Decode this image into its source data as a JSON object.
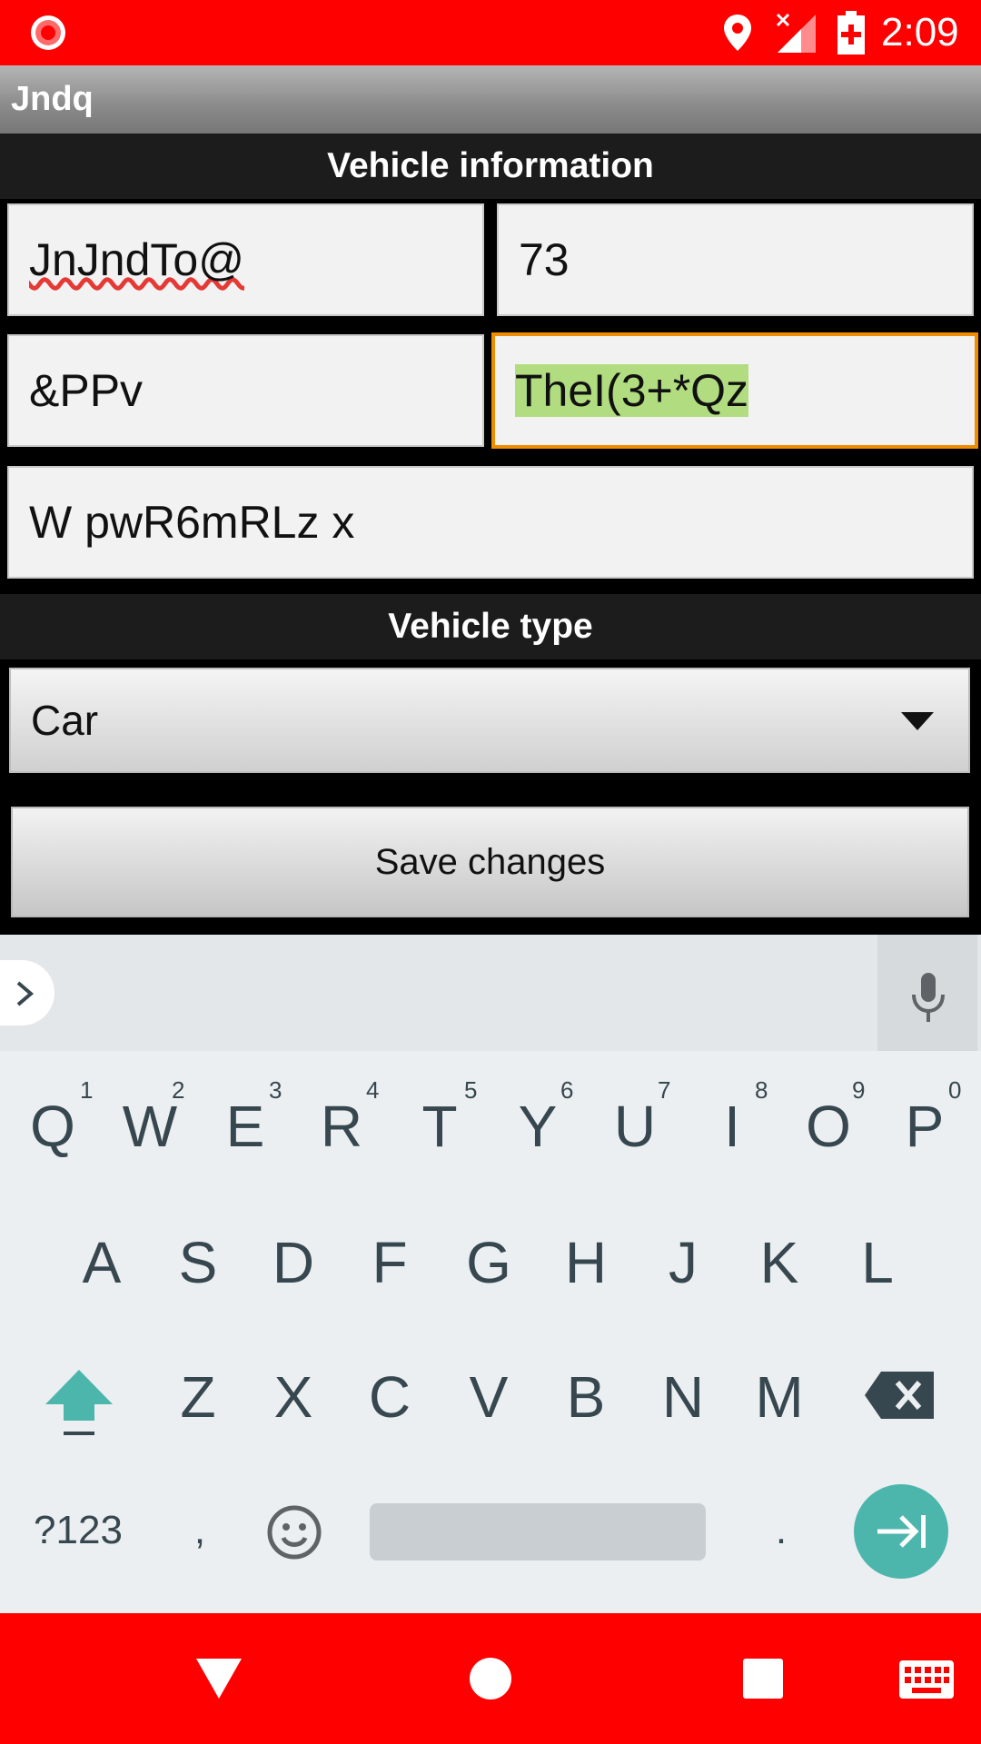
{
  "status_bar": {
    "time": "2:09"
  },
  "app": {
    "title": "Jndq"
  },
  "sections": {
    "vehicle_information": "Vehicle information",
    "vehicle_type": "Vehicle type"
  },
  "fields": {
    "field1": "JnJndTo@",
    "field2": "73",
    "field3": "&PPv",
    "field4": "TheI(3+*Qz",
    "field5": "W pwR6mRLz x"
  },
  "spinner": {
    "selected": "Car"
  },
  "buttons": {
    "save": "Save changes"
  },
  "keyboard": {
    "row1": [
      {
        "key": "Q",
        "hint": "1"
      },
      {
        "key": "W",
        "hint": "2"
      },
      {
        "key": "E",
        "hint": "3"
      },
      {
        "key": "R",
        "hint": "4"
      },
      {
        "key": "T",
        "hint": "5"
      },
      {
        "key": "Y",
        "hint": "6"
      },
      {
        "key": "U",
        "hint": "7"
      },
      {
        "key": "I",
        "hint": "8"
      },
      {
        "key": "O",
        "hint": "9"
      },
      {
        "key": "P",
        "hint": "0"
      }
    ],
    "row2": [
      "A",
      "S",
      "D",
      "F",
      "G",
      "H",
      "J",
      "K",
      "L"
    ],
    "row3": [
      "Z",
      "X",
      "C",
      "V",
      "B",
      "N",
      "M"
    ],
    "symbols_label": "?123",
    "comma": ",",
    "period": "."
  },
  "colors": {
    "status_bar": "#ff0000",
    "nav_bar": "#ff0000",
    "focus_border": "#f08c00",
    "selection_highlight": "#b1dd80",
    "enter_key": "#4db6ac"
  },
  "icons": [
    "record-icon",
    "location-icon",
    "signal-icon",
    "battery-icon",
    "chevron-right-icon",
    "mic-icon",
    "shift-icon",
    "backspace-icon",
    "emoji-icon",
    "enter-tab-icon",
    "back-icon",
    "home-icon",
    "recents-icon",
    "keyboard-icon"
  ]
}
